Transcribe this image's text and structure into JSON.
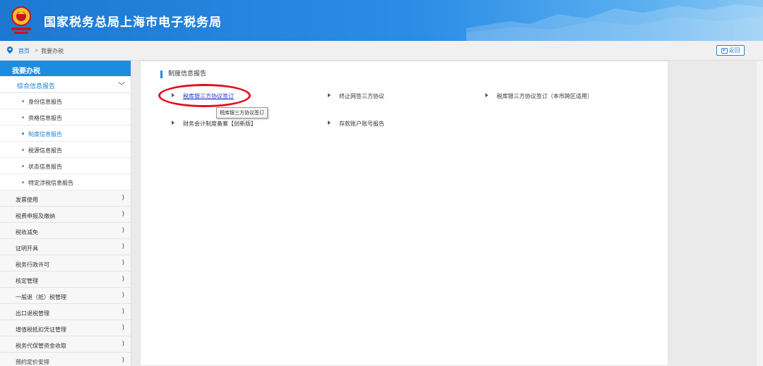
{
  "header": {
    "title": "国家税务总局上海市电子税务局"
  },
  "breadcrumb": {
    "home": "首页",
    "separator": ">",
    "current": "我要办税",
    "back_label": "返回"
  },
  "sidebar": {
    "heading": "我要办税",
    "group": {
      "label": "综合信息报告",
      "chevron": "﹀"
    },
    "sub_items": [
      {
        "label": "身份信息报告"
      },
      {
        "label": "资格信息报告"
      },
      {
        "label": "制度信息报告"
      },
      {
        "label": "税源信息报告"
      },
      {
        "label": "状态信息报告"
      },
      {
        "label": "特定涉税信息报告"
      }
    ],
    "menu_items": [
      {
        "label": "发票使用",
        "arrow": ")"
      },
      {
        "label": "税费申报及缴纳",
        "arrow": ")"
      },
      {
        "label": "税收减免",
        "arrow": ")"
      },
      {
        "label": "证明开具",
        "arrow": ")"
      },
      {
        "label": "税务行政许可",
        "arrow": ")"
      },
      {
        "label": "核定管理",
        "arrow": ")"
      },
      {
        "label": "一般退（抵）税管理",
        "arrow": ")"
      },
      {
        "label": "出口退税管理",
        "arrow": ")"
      },
      {
        "label": "增值税抵扣凭证管理",
        "arrow": ")"
      },
      {
        "label": "税务代保管资金收取",
        "arrow": ")"
      },
      {
        "label": "预约定价安排",
        "arrow": ")"
      }
    ]
  },
  "main": {
    "section_title": "制度信息报告",
    "links": [
      {
        "label": "税库银三方协议签订"
      },
      {
        "label": "终止网签三方协议"
      },
      {
        "label": "税库银三方协议签订（本市跨区适用）"
      },
      {
        "label": "财务会计制度备案【创新版】"
      },
      {
        "label": "存款账户账号报告"
      }
    ],
    "tooltip": "税库银三方协议签订"
  },
  "colors": {
    "header_blue": "#1d78d2",
    "sidebar_active": "#1c8ce0",
    "highlight_circle": "#e0101e"
  }
}
